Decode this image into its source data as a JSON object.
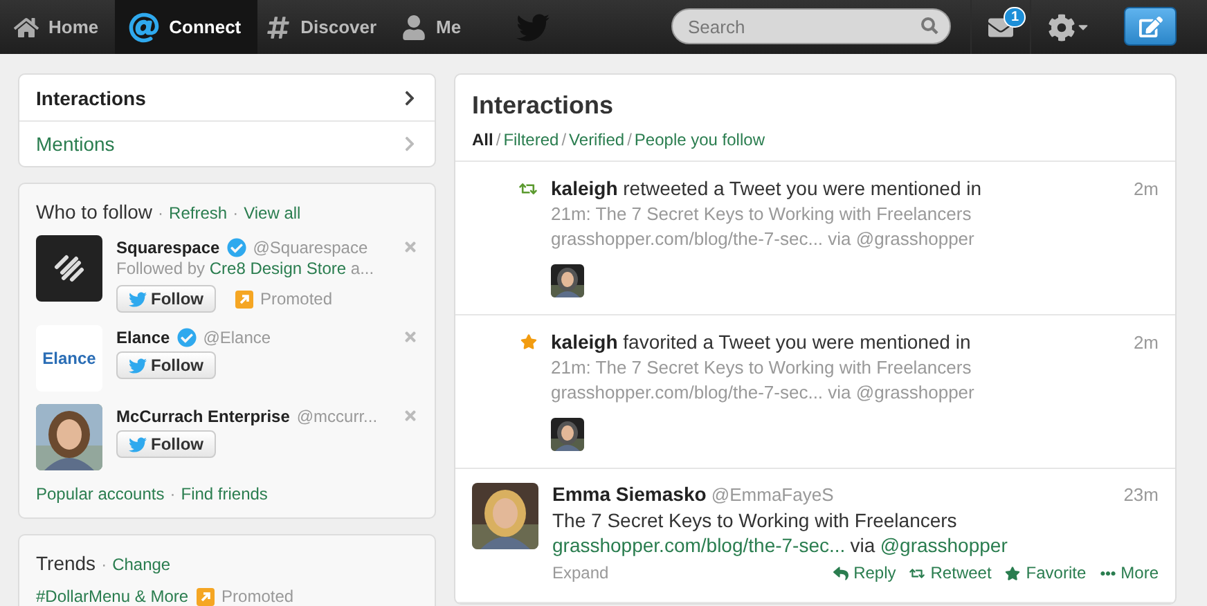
{
  "topbar": {
    "items": [
      {
        "kind": "home",
        "label": "Home",
        "selected": false
      },
      {
        "kind": "connect",
        "label": "Connect",
        "selected": true
      },
      {
        "kind": "discover",
        "label": "Discover",
        "selected": false
      },
      {
        "kind": "me",
        "label": "Me",
        "selected": false
      }
    ],
    "search": {
      "placeholder": "Search"
    },
    "messages_badge": "1"
  },
  "sidebar": {
    "nav": [
      {
        "label": "Interactions",
        "selected": true
      },
      {
        "label": "Mentions",
        "selected": false
      }
    ],
    "who_to_follow": {
      "title": "Who to follow",
      "separator": "·",
      "links": [
        "Refresh",
        "View all"
      ],
      "accounts": [
        {
          "kind": "squarespace",
          "name": "Squarespace",
          "verified": true,
          "handle": "@Squarespace",
          "followed_by": [
            "Followed by ",
            "Cre8 Design Store",
            " a..."
          ],
          "button": "Follow",
          "promoted": "Promoted"
        },
        {
          "kind": "elance",
          "logo_text": "Elance",
          "name": "Elance",
          "verified": true,
          "handle": "@Elance",
          "button": "Follow"
        },
        {
          "kind": "picture",
          "name": "McCurrach Enterprise",
          "verified": false,
          "handle": "@mccurr...",
          "button": "Follow"
        }
      ],
      "footer_links": [
        "Popular accounts",
        "Find friends"
      ]
    },
    "trends": {
      "title": "Trends",
      "separator": "·",
      "link": "Change",
      "items": [
        {
          "label": "#DollarMenu & More",
          "promoted": "Promoted"
        }
      ]
    }
  },
  "main": {
    "title": "Interactions",
    "filter_separator": "/",
    "filters": [
      {
        "label": "All",
        "selected": true
      },
      {
        "label": "Filtered",
        "selected": false
      },
      {
        "label": "Verified",
        "selected": false
      },
      {
        "label": "People you follow",
        "selected": false
      }
    ],
    "activities": [
      {
        "kind": "retweet",
        "user": "kaleigh",
        "action": "retweeted a Tweet you were mentioned in",
        "time": "2m",
        "line1": "21m: The 7 Secret Keys to Working with Freelancers",
        "line2": "grasshopper.com/blog/the-7-sec... via @grasshopper"
      },
      {
        "kind": "favorite",
        "user": "kaleigh",
        "action": "favorited a Tweet you were mentioned in",
        "time": "2m",
        "line1": "21m: The 7 Secret Keys to Working with Freelancers",
        "line2": "grasshopper.com/blog/the-7-sec... via @grasshopper"
      }
    ],
    "tweets": [
      {
        "name": "Emma Siemasko",
        "handle": "@EmmaFayeS",
        "time": "23m",
        "text": "The 7 Secret Keys to Working with Freelancers",
        "link": "grasshopper.com/blog/the-7-sec...",
        "via": "via",
        "via_handle": "@grasshopper",
        "expand": "Expand",
        "actions": [
          {
            "kind": "reply",
            "label": "Reply"
          },
          {
            "kind": "retweet",
            "label": "Retweet"
          },
          {
            "kind": "favorite",
            "label": "Favorite"
          },
          {
            "kind": "more",
            "label": "More"
          }
        ]
      }
    ]
  }
}
